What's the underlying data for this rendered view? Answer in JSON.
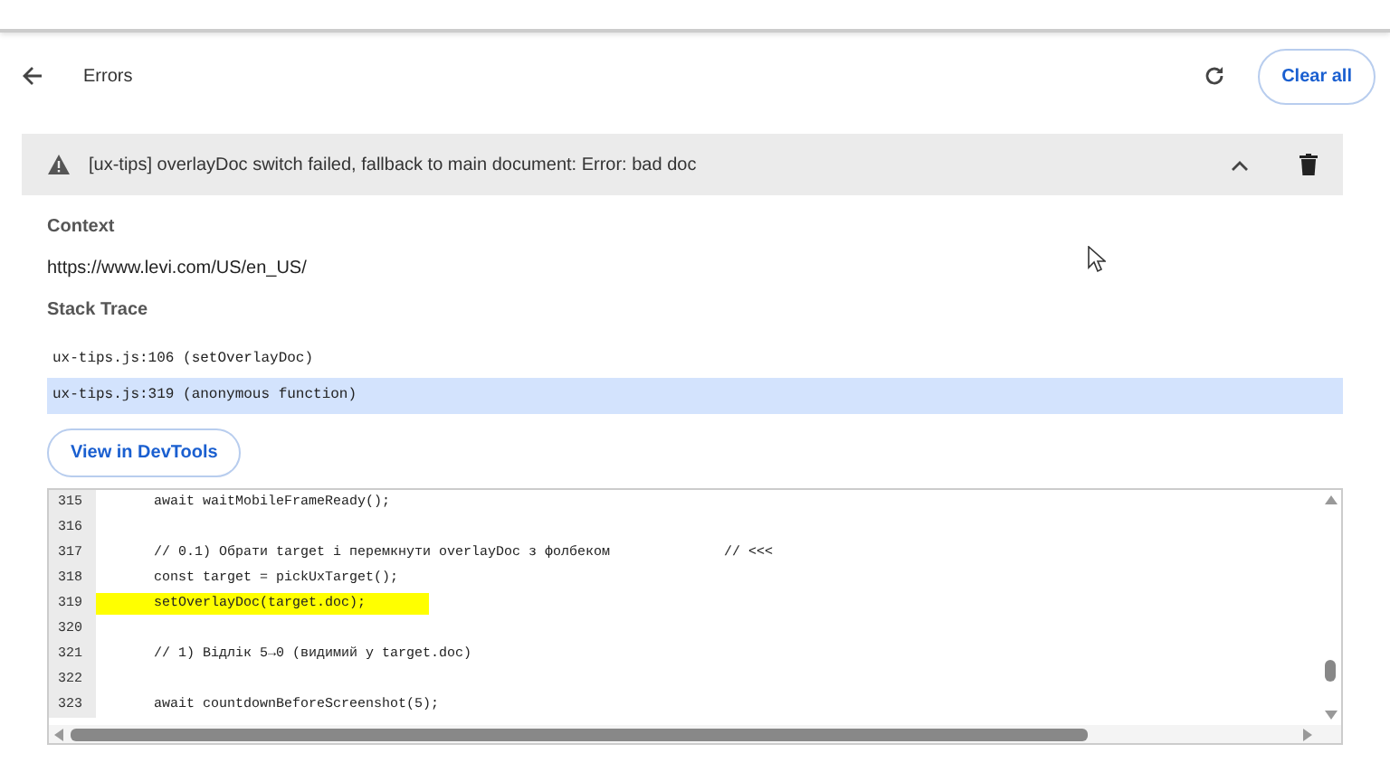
{
  "header": {
    "title": "Errors",
    "clear_button": "Clear all"
  },
  "error": {
    "message": "[ux-tips] overlayDoc switch failed, fallback to main document: Error: bad doc",
    "expanded": true
  },
  "context": {
    "heading": "Context",
    "url": "https://www.levi.com/US/en_US/"
  },
  "stack_trace": {
    "heading": "Stack Trace",
    "frames": [
      {
        "text": "ux-tips.js:106 (setOverlayDoc)",
        "selected": false
      },
      {
        "text": "ux-tips.js:319 (anonymous function)",
        "selected": true
      }
    ]
  },
  "devtools_button": "View in DevTools",
  "code": {
    "lines": [
      {
        "number": "315",
        "text": "    await waitMobileFrameReady();",
        "highlighted": false
      },
      {
        "number": "316",
        "highlighted": false
      },
      {
        "number": "317",
        "text": "    // 0.1) Обрати target і перемкнути overlayDoc з фолбеком              // <<<",
        "highlighted": false
      },
      {
        "number": "318",
        "text": "    const target = pickUxTarget();",
        "highlighted": false
      },
      {
        "number": "319",
        "text": "    setOverlayDoc(target.doc);",
        "highlighted": true
      },
      {
        "number": "320",
        "highlighted": false
      },
      {
        "number": "321",
        "text": "    // 1) Відлік 5→0 (видимий у target.doc)",
        "highlighted": false
      },
      {
        "number": "322",
        "highlighted": false
      },
      {
        "number": "323",
        "text": "    await countdownBeforeScreenshot(5);",
        "highlighted": false
      }
    ]
  }
}
